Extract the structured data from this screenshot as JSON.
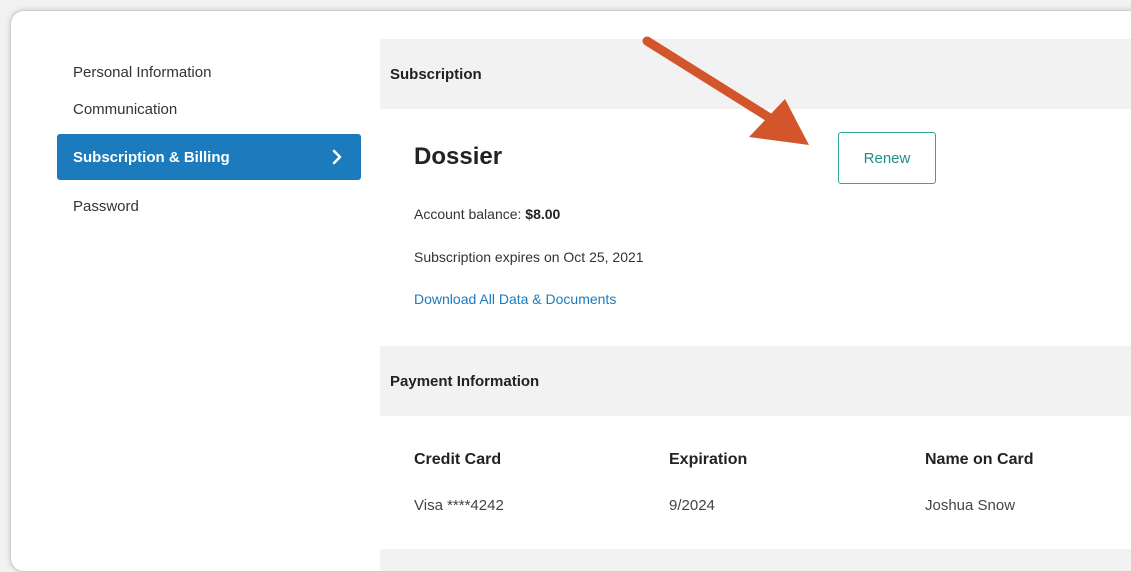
{
  "sidebar": {
    "items": [
      {
        "label": "Personal Information"
      },
      {
        "label": "Communication"
      },
      {
        "label": "Subscription & Billing"
      },
      {
        "label": "Password"
      }
    ]
  },
  "subscription": {
    "header": "Subscription",
    "plan_name": "Dossier",
    "renew_label": "Renew",
    "balance_label": "Account balance: ",
    "balance_value": "$8.00",
    "expires_text": "Subscription expires on Oct 25, 2021",
    "download_link": "Download All Data & Documents"
  },
  "payment": {
    "header": "Payment Information",
    "columns": [
      "Credit Card",
      "Expiration",
      "Name on Card"
    ],
    "values": [
      "Visa ****4242",
      "9/2024",
      "Joshua Snow"
    ]
  },
  "colors": {
    "accent": "#1c7bbd",
    "renew": "#2aa89a",
    "arrow": "#d3552b"
  },
  "icons": {
    "active_item": "chevron-right-icon",
    "annotation": "arrow-annotation"
  }
}
